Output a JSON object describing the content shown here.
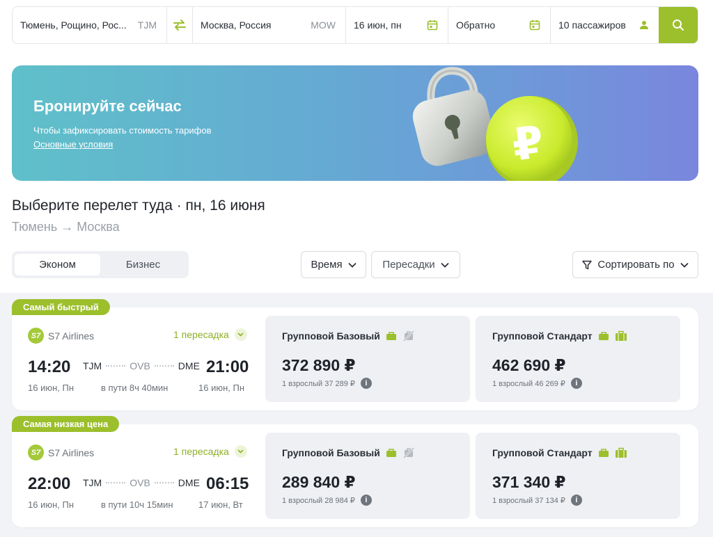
{
  "search": {
    "from_city": "Тюмень, Рощино, Рос...",
    "from_code": "TJM",
    "to_city": "Москва, Россия",
    "to_code": "MOW",
    "date": "16 июн, пн",
    "return": "Обратно",
    "passengers": "10 пассажиров"
  },
  "banner": {
    "title": "Бронируйте сейчас",
    "subtitle": "Чтобы зафиксировать стоимость тарифов",
    "link": "Основные условия"
  },
  "heading": {
    "title": "Выберите перелет туда · пн, 16 июня",
    "route": "Тюмень → Москва"
  },
  "filters": {
    "class_tabs": [
      "Эконом",
      "Бизнес"
    ],
    "time": "Время",
    "transfers": "Пересадки",
    "sort": "Сортировать по"
  },
  "colors": {
    "accent": "#9cbf2c",
    "banner_start": "#5fc0c9",
    "banner_end": "#7a86dd"
  },
  "flights": [
    {
      "tag": "Самый быстрый",
      "airline": "S7 Airlines",
      "stops": "1 пересадка",
      "dep_time": "14:20",
      "arr_time": "21:00",
      "from": "TJM",
      "via": "OVB",
      "to": "DME",
      "dep_date": "16 июн, Пн",
      "duration": "в пути 8ч 40мин",
      "arr_date": "16 июн, Пн",
      "fares": [
        {
          "name": "Групповой Базовый",
          "price": "372 890 ₽",
          "note": "1 взрослый 37 289 ₽"
        },
        {
          "name": "Групповой Стандарт",
          "price": "462 690 ₽",
          "note": "1 взрослый 46 269 ₽"
        }
      ]
    },
    {
      "tag": "Самая низкая цена",
      "airline": "S7 Airlines",
      "stops": "1 пересадка",
      "dep_time": "22:00",
      "arr_time": "06:15",
      "from": "TJM",
      "via": "OVB",
      "to": "DME",
      "dep_date": "16 июн, Пн",
      "duration": "в пути 10ч 15мин",
      "arr_date": "17 июн, Вт",
      "fares": [
        {
          "name": "Групповой Базовый",
          "price": "289 840 ₽",
          "note": "1 взрослый 28 984 ₽"
        },
        {
          "name": "Групповой Стандарт",
          "price": "371 340 ₽",
          "note": "1 взрослый 37 134 ₽"
        }
      ]
    }
  ]
}
